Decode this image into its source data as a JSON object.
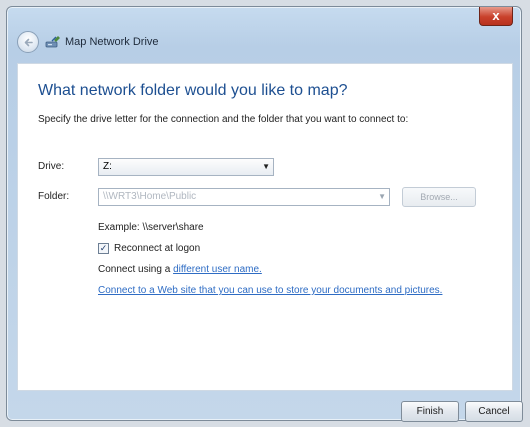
{
  "window": {
    "title": "Map Network Drive",
    "close_label": "x"
  },
  "main": {
    "heading": "What network folder would you like to map?",
    "description": "Specify the drive letter for the connection and the folder that you want to connect to:",
    "drive": {
      "label": "Drive:",
      "value": "Z:"
    },
    "folder": {
      "label": "Folder:",
      "value": "\\\\WRT3\\Home\\Public"
    },
    "browse_label": "Browse...",
    "example": "Example: \\\\server\\share",
    "reconnect": {
      "label": "Reconnect at logon",
      "checked": true
    },
    "connect_prefix": "Connect using a ",
    "connect_link": "different user name.",
    "web_link": "Connect to a Web site that you can use to store your documents and pictures."
  },
  "footer": {
    "finish_label": "Finish",
    "cancel_label": "Cancel"
  },
  "colors": {
    "heading": "#1d4f91",
    "link": "#2e6cc4",
    "close_button": "#c9412b"
  },
  "icons": {
    "back": "back-arrow-icon",
    "wizard": "network-drive-icon",
    "dropdown": "chevron-down-icon",
    "check": "checkmark-icon"
  }
}
